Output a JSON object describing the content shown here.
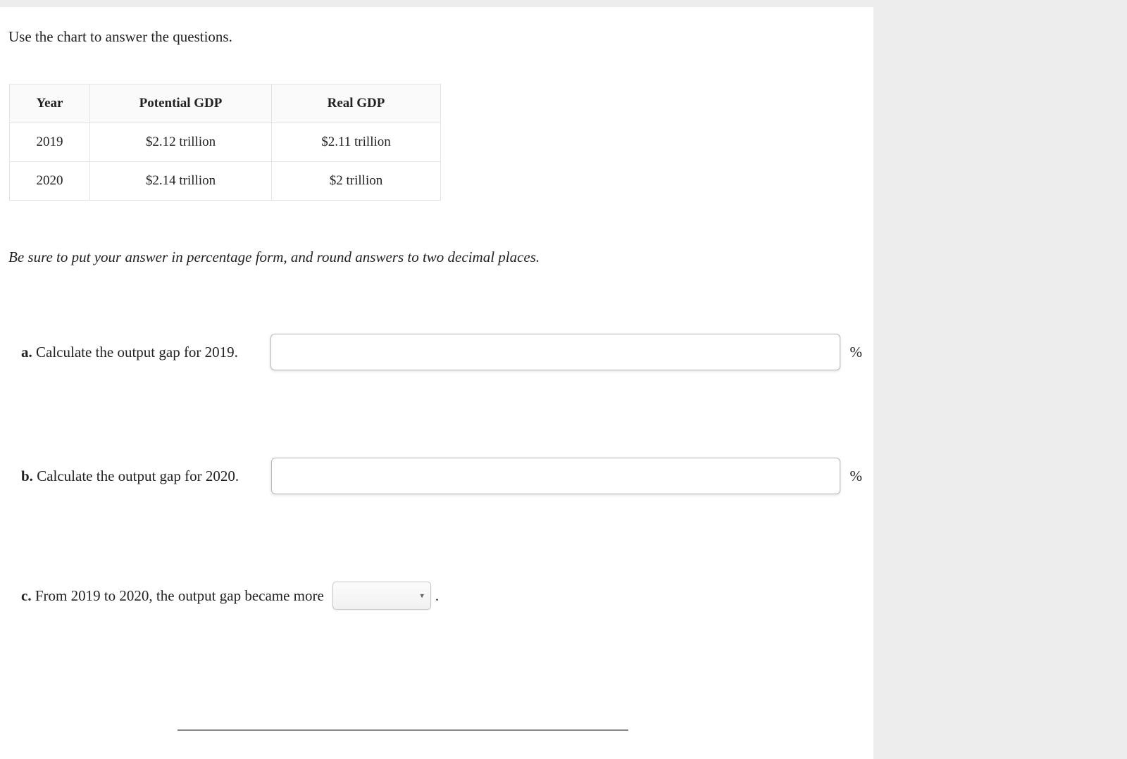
{
  "intro": "Use the chart to answer the questions.",
  "table": {
    "headers": [
      "Year",
      "Potential GDP",
      "Real GDP"
    ],
    "rows": [
      {
        "year": "2019",
        "potential": "$2.12 trillion",
        "real": "$2.11 trillion"
      },
      {
        "year": "2020",
        "potential": "$2.14 trillion",
        "real": "$2 trillion"
      }
    ]
  },
  "note": "Be sure to put your answer in percentage form, and round answers to two decimal places.",
  "questions": {
    "a": {
      "label": "a.",
      "text": "Calculate the output gap for 2019.",
      "unit": "%"
    },
    "b": {
      "label": "b.",
      "text": "Calculate the output gap for 2020.",
      "unit": "%"
    },
    "c": {
      "label": "c.",
      "text_before": "From 2019 to 2020, the output gap became more",
      "text_after": "."
    }
  },
  "chart_data": {
    "type": "table",
    "title": "Potential vs Real GDP",
    "columns": [
      "Year",
      "Potential GDP (trillion $)",
      "Real GDP (trillion $)"
    ],
    "rows": [
      [
        "2019",
        2.12,
        2.11
      ],
      [
        "2020",
        2.14,
        2.0
      ]
    ]
  }
}
